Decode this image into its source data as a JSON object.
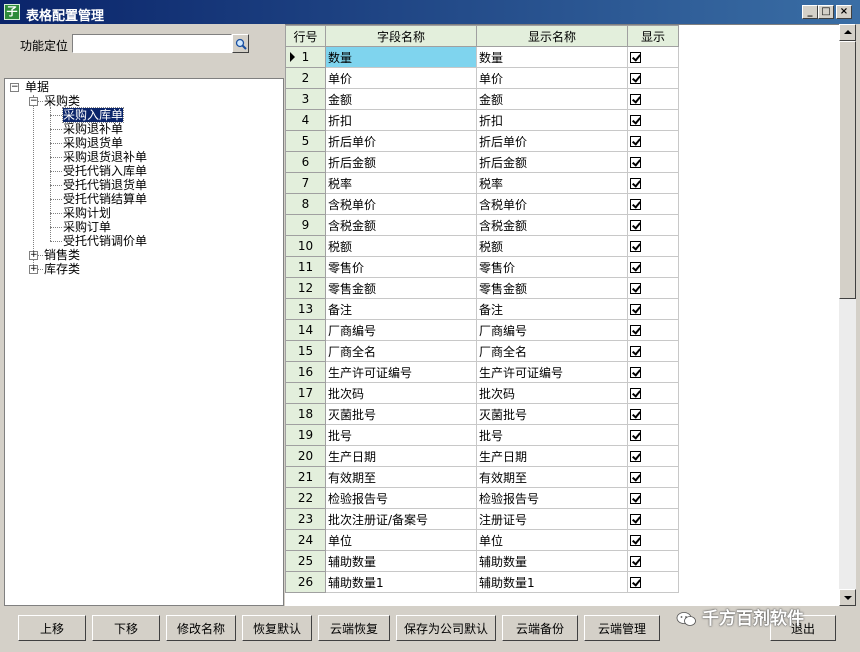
{
  "window": {
    "title": "表格配置管理",
    "app_icon_glyph": "子",
    "minimize_glyph": "_",
    "maximize_glyph": "□",
    "close_glyph": "×"
  },
  "locate": {
    "label": "功能定位",
    "value": "",
    "placeholder": ""
  },
  "tree": {
    "root": "单据",
    "purchase": "采购类",
    "purchase_items": [
      "采购入库单",
      "采购退补单",
      "采购退货单",
      "采购退货退补单",
      "受托代销入库单",
      "受托代销退货单",
      "受托代销结算单",
      "采购计划",
      "采购订单",
      "受托代销调价单"
    ],
    "sales": "销售类",
    "inventory": "库存类",
    "selected_index": 0
  },
  "grid": {
    "headers": [
      "行号",
      "字段名称",
      "显示名称",
      "显示"
    ],
    "rows": [
      {
        "no": "1",
        "field": "数量",
        "display": "数量",
        "shown": true
      },
      {
        "no": "2",
        "field": "单价",
        "display": "单价",
        "shown": true
      },
      {
        "no": "3",
        "field": "金额",
        "display": "金额",
        "shown": true
      },
      {
        "no": "4",
        "field": "折扣",
        "display": "折扣",
        "shown": true
      },
      {
        "no": "5",
        "field": "折后单价",
        "display": "折后单价",
        "shown": true
      },
      {
        "no": "6",
        "field": "折后金额",
        "display": "折后金额",
        "shown": true
      },
      {
        "no": "7",
        "field": "税率",
        "display": "税率",
        "shown": true
      },
      {
        "no": "8",
        "field": "含税单价",
        "display": "含税单价",
        "shown": true
      },
      {
        "no": "9",
        "field": "含税金额",
        "display": "含税金额",
        "shown": true
      },
      {
        "no": "10",
        "field": "税额",
        "display": "税额",
        "shown": true
      },
      {
        "no": "11",
        "field": "零售价",
        "display": "零售价",
        "shown": true
      },
      {
        "no": "12",
        "field": "零售金额",
        "display": "零售金额",
        "shown": true
      },
      {
        "no": "13",
        "field": "备注",
        "display": "备注",
        "shown": true
      },
      {
        "no": "14",
        "field": "厂商编号",
        "display": "厂商编号",
        "shown": true
      },
      {
        "no": "15",
        "field": "厂商全名",
        "display": "厂商全名",
        "shown": true
      },
      {
        "no": "16",
        "field": "生产许可证编号",
        "display": "生产许可证编号",
        "shown": true
      },
      {
        "no": "17",
        "field": "批次码",
        "display": "批次码",
        "shown": true
      },
      {
        "no": "18",
        "field": "灭菌批号",
        "display": "灭菌批号",
        "shown": true
      },
      {
        "no": "19",
        "field": "批号",
        "display": "批号",
        "shown": true
      },
      {
        "no": "20",
        "field": "生产日期",
        "display": "生产日期",
        "shown": true
      },
      {
        "no": "21",
        "field": "有效期至",
        "display": "有效期至",
        "shown": true
      },
      {
        "no": "22",
        "field": "检验报告号",
        "display": "检验报告号",
        "shown": true
      },
      {
        "no": "23",
        "field": "批次注册证/备案号",
        "display": "注册证号",
        "shown": true
      },
      {
        "no": "24",
        "field": "单位",
        "display": "单位",
        "shown": true
      },
      {
        "no": "25",
        "field": "辅助数量",
        "display": "辅助数量",
        "shown": true
      },
      {
        "no": "26",
        "field": "辅助数量1",
        "display": "辅助数量1",
        "shown": true
      }
    ],
    "current_row": 0
  },
  "buttons": {
    "move_up": "上移",
    "move_down": "下移",
    "rename": "修改名称",
    "restore_default": "恢复默认",
    "cloud_restore": "云端恢复",
    "save_company_default": "保存为公司默认",
    "cloud_backup": "云端备份",
    "cloud_manage": "云端管理",
    "exit": "退出"
  },
  "watermark": {
    "text": "千方百剂软件",
    "icon": "wechat-icon"
  },
  "colors": {
    "header_bg": "#e3efdc",
    "current_cell": "#7fd4ee",
    "title_start": "#0a246a",
    "title_end": "#3a6ea5"
  }
}
